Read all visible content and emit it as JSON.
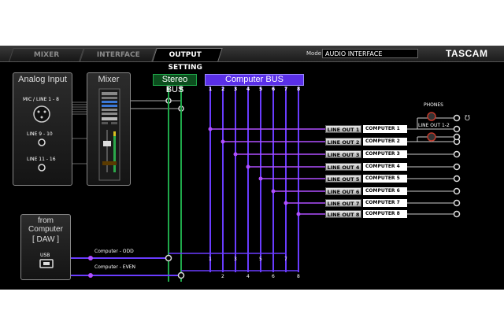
{
  "tabs": [
    {
      "label": "MIXER"
    },
    {
      "label": "INTERFACE"
    },
    {
      "label": "OUTPUT SETTING"
    }
  ],
  "mode": {
    "label": "Mode",
    "value": "AUDIO INTERFACE"
  },
  "brand": "TASCAM",
  "analog_input": {
    "title": "Analog Input",
    "inputs": [
      "MIC / LINE 1 - 8",
      "LINE 9 - 10",
      "LINE 11 - 16"
    ]
  },
  "mixer": {
    "title": "Mixer"
  },
  "stereo_bus": {
    "title": "Stereo BUS",
    "left": "L",
    "right": "R"
  },
  "computer_bus": {
    "title": "Computer BUS",
    "channels": [
      "1",
      "2",
      "3",
      "4",
      "5",
      "6",
      "7",
      "8"
    ]
  },
  "from_computer": {
    "title_line1": "from",
    "title_line2": "Computer",
    "daw": "[ DAW ]",
    "usb": "USB"
  },
  "computer_paths": {
    "odd": "Computer - ODD",
    "even": "Computer - EVEN"
  },
  "bottom_numbers_odd": [
    "1",
    "3",
    "5",
    "7"
  ],
  "bottom_numbers_even": [
    "2",
    "4",
    "6",
    "8"
  ],
  "line_outs": [
    {
      "label": "LINE OUT 1",
      "source": "COMPUTER 1"
    },
    {
      "label": "LINE OUT 2",
      "source": "COMPUTER 2"
    },
    {
      "label": "LINE OUT 3",
      "source": "COMPUTER 3"
    },
    {
      "label": "LINE OUT 4",
      "source": "COMPUTER 4"
    },
    {
      "label": "LINE OUT 5",
      "source": "COMPUTER 5"
    },
    {
      "label": "LINE OUT 6",
      "source": "COMPUTER 6"
    },
    {
      "label": "LINE OUT 7",
      "source": "COMPUTER 7"
    },
    {
      "label": "LINE OUT 8",
      "source": "COMPUTER 8"
    }
  ],
  "phones": {
    "label": "PHONES",
    "line_out_label": "LINE OUT 1-2"
  },
  "colors": {
    "stereo_bus": "#1fa84a",
    "computer_bus": "#6a3cff",
    "signal": "#b04fff"
  }
}
